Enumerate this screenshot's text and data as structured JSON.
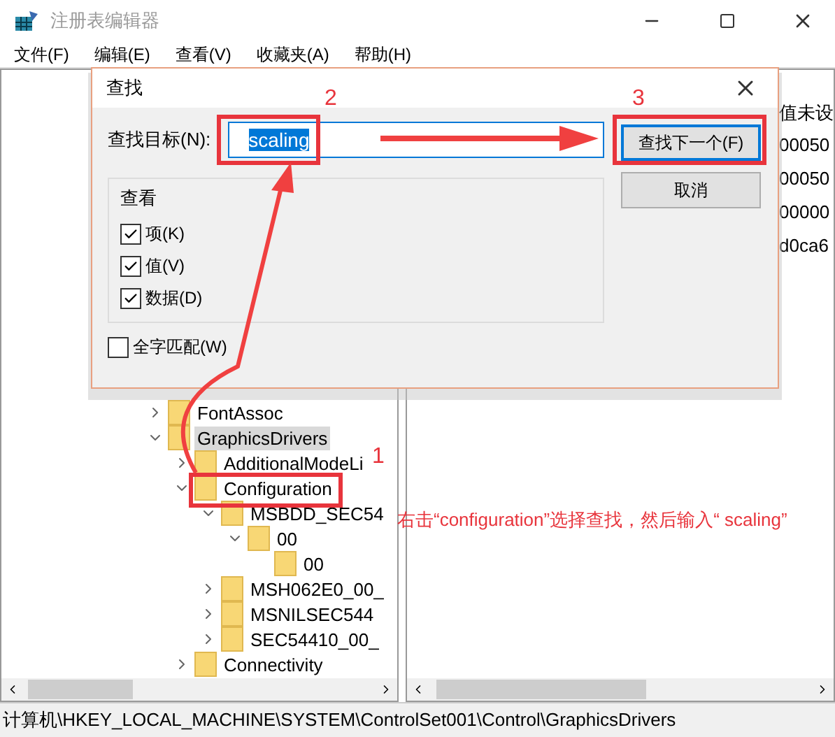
{
  "window": {
    "title": "注册表编辑器"
  },
  "menu": [
    "文件(F)",
    "编辑(E)",
    "查看(V)",
    "收藏夹(A)",
    "帮助(H)"
  ],
  "tree": [
    {
      "label": "FontAssoc",
      "expanded": false,
      "selected": false
    },
    {
      "label": "GraphicsDrivers",
      "expanded": true,
      "selected": true,
      "children": [
        {
          "label": "AdditionalModeLi",
          "expanded": false,
          "selected": false
        },
        {
          "label": "Configuration",
          "expanded": true,
          "selected": false,
          "children": [
            {
              "label": "MSBDD_SEC54",
              "expanded": true,
              "selected": false,
              "children": [
                {
                  "label": "00",
                  "expanded": true,
                  "selected": false,
                  "children": [
                    {
                      "label": "00",
                      "selected": false
                    }
                  ]
                }
              ]
            },
            {
              "label": "MSH062E0_00_",
              "expanded": false,
              "selected": false
            },
            {
              "label": "MSNILSEC544",
              "expanded": false,
              "selected": false
            },
            {
              "label": "SEC54410_00_",
              "expanded": false,
              "selected": false
            }
          ]
        },
        {
          "label": "Connectivity",
          "expanded": false,
          "selected": false
        }
      ]
    }
  ],
  "values": [
    "值未设",
    "00050",
    "00050",
    "00000",
    "d0ca6"
  ],
  "status_bar": "计算机\\HKEY_LOCAL_MACHINE\\SYSTEM\\ControlSet001\\Control\\GraphicsDrivers",
  "find_dialog": {
    "title": "查找",
    "target_label": "查找目标(N):",
    "target_value": "scaling",
    "look_at": {
      "title": "查看",
      "options": [
        {
          "label": "项(K)",
          "checked": true
        },
        {
          "label": "值(V)",
          "checked": true
        },
        {
          "label": "数据(D)",
          "checked": true
        }
      ]
    },
    "whole_word": {
      "label": "全字匹配(W)",
      "checked": false
    },
    "buttons": [
      "查找下一个(F)",
      "取消"
    ]
  },
  "annotations": {
    "steps": [
      "2",
      "3",
      "1"
    ],
    "note": "右击“configuration”选择查找，然后输入“ scaling”"
  }
}
